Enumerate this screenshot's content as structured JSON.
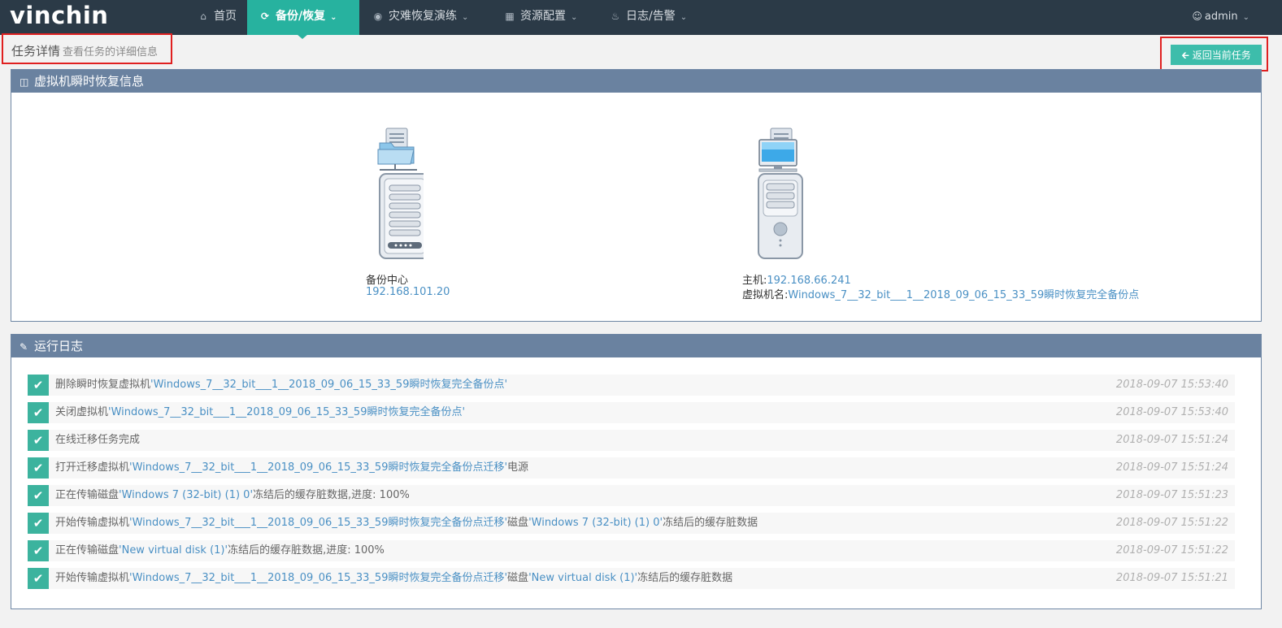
{
  "app": {
    "logo": "vinchin"
  },
  "nav": {
    "items": [
      {
        "label": "首页",
        "icon": "home-icon"
      },
      {
        "label": "备份/恢复",
        "icon": "refresh-icon",
        "active": true
      },
      {
        "label": "灾难恢复演练",
        "icon": "target-icon"
      },
      {
        "label": "资源配置",
        "icon": "grid-icon"
      },
      {
        "label": "日志/告警",
        "icon": "bell-icon"
      }
    ],
    "user": "admin"
  },
  "header": {
    "title": "任务详情",
    "subtitle": "查看任务的详细信息",
    "back_button": "返回当前任务"
  },
  "restore_panel": {
    "title": "虚拟机瞬时恢复信息",
    "backup_center": {
      "label": "备份中心",
      "ip": "192.168.101.20"
    },
    "host": {
      "label": "主机:",
      "ip": "192.168.66.241",
      "vm_label": "虚拟机名:",
      "vm_name": "Windows_7__32_bit___1__2018_09_06_15_33_59瞬时恢复完全备份点"
    }
  },
  "log_panel": {
    "title": "运行日志",
    "entries": [
      {
        "prefix": "删除瞬时恢复虚拟机",
        "q1": "'Windows_7__32_bit___1__2018_09_06_15_33_59瞬时恢复完全备份点'",
        "mid": "",
        "q2": "",
        "suffix": "",
        "time": "2018-09-07 15:53:40"
      },
      {
        "prefix": "关闭虚拟机",
        "q1": "'Windows_7__32_bit___1__2018_09_06_15_33_59瞬时恢复完全备份点'",
        "mid": "",
        "q2": "",
        "suffix": "",
        "time": "2018-09-07 15:53:40"
      },
      {
        "prefix": "在线迁移任务完成",
        "q1": "",
        "mid": "",
        "q2": "",
        "suffix": "",
        "time": "2018-09-07 15:51:24"
      },
      {
        "prefix": "打开迁移虚拟机",
        "q1": "'Windows_7__32_bit___1__2018_09_06_15_33_59瞬时恢复完全备份点迁移'",
        "mid": "",
        "q2": "",
        "suffix": "电源",
        "time": "2018-09-07 15:51:24"
      },
      {
        "prefix": "正在传输磁盘",
        "q1": "'Windows 7 (32-bit) (1) 0'",
        "mid": "",
        "q2": "",
        "suffix": "冻结后的缓存脏数据,进度: 100%",
        "time": "2018-09-07 15:51:23"
      },
      {
        "prefix": "开始传输虚拟机",
        "q1": "'Windows_7__32_bit___1__2018_09_06_15_33_59瞬时恢复完全备份点迁移'",
        "mid": "磁盘",
        "q2": "'Windows 7 (32-bit) (1) 0'",
        "suffix": "冻结后的缓存脏数据",
        "time": "2018-09-07 15:51:22"
      },
      {
        "prefix": "正在传输磁盘",
        "q1": "'New virtual disk (1)'",
        "mid": "",
        "q2": "",
        "suffix": "冻结后的缓存脏数据,进度: 100%",
        "time": "2018-09-07 15:51:22"
      },
      {
        "prefix": "开始传输虚拟机",
        "q1": "'Windows_7__32_bit___1__2018_09_06_15_33_59瞬时恢复完全备份点迁移'",
        "mid": "磁盘",
        "q2": "'New virtual disk (1)'",
        "suffix": "冻结后的缓存脏数据",
        "time": "2018-09-07 15:51:21"
      }
    ]
  },
  "colors": {
    "nav_bg": "#2b3a47",
    "accent": "#27b29f",
    "panel_head": "#6a82a0",
    "link": "#4a90c4",
    "highlight": "#e02020"
  }
}
